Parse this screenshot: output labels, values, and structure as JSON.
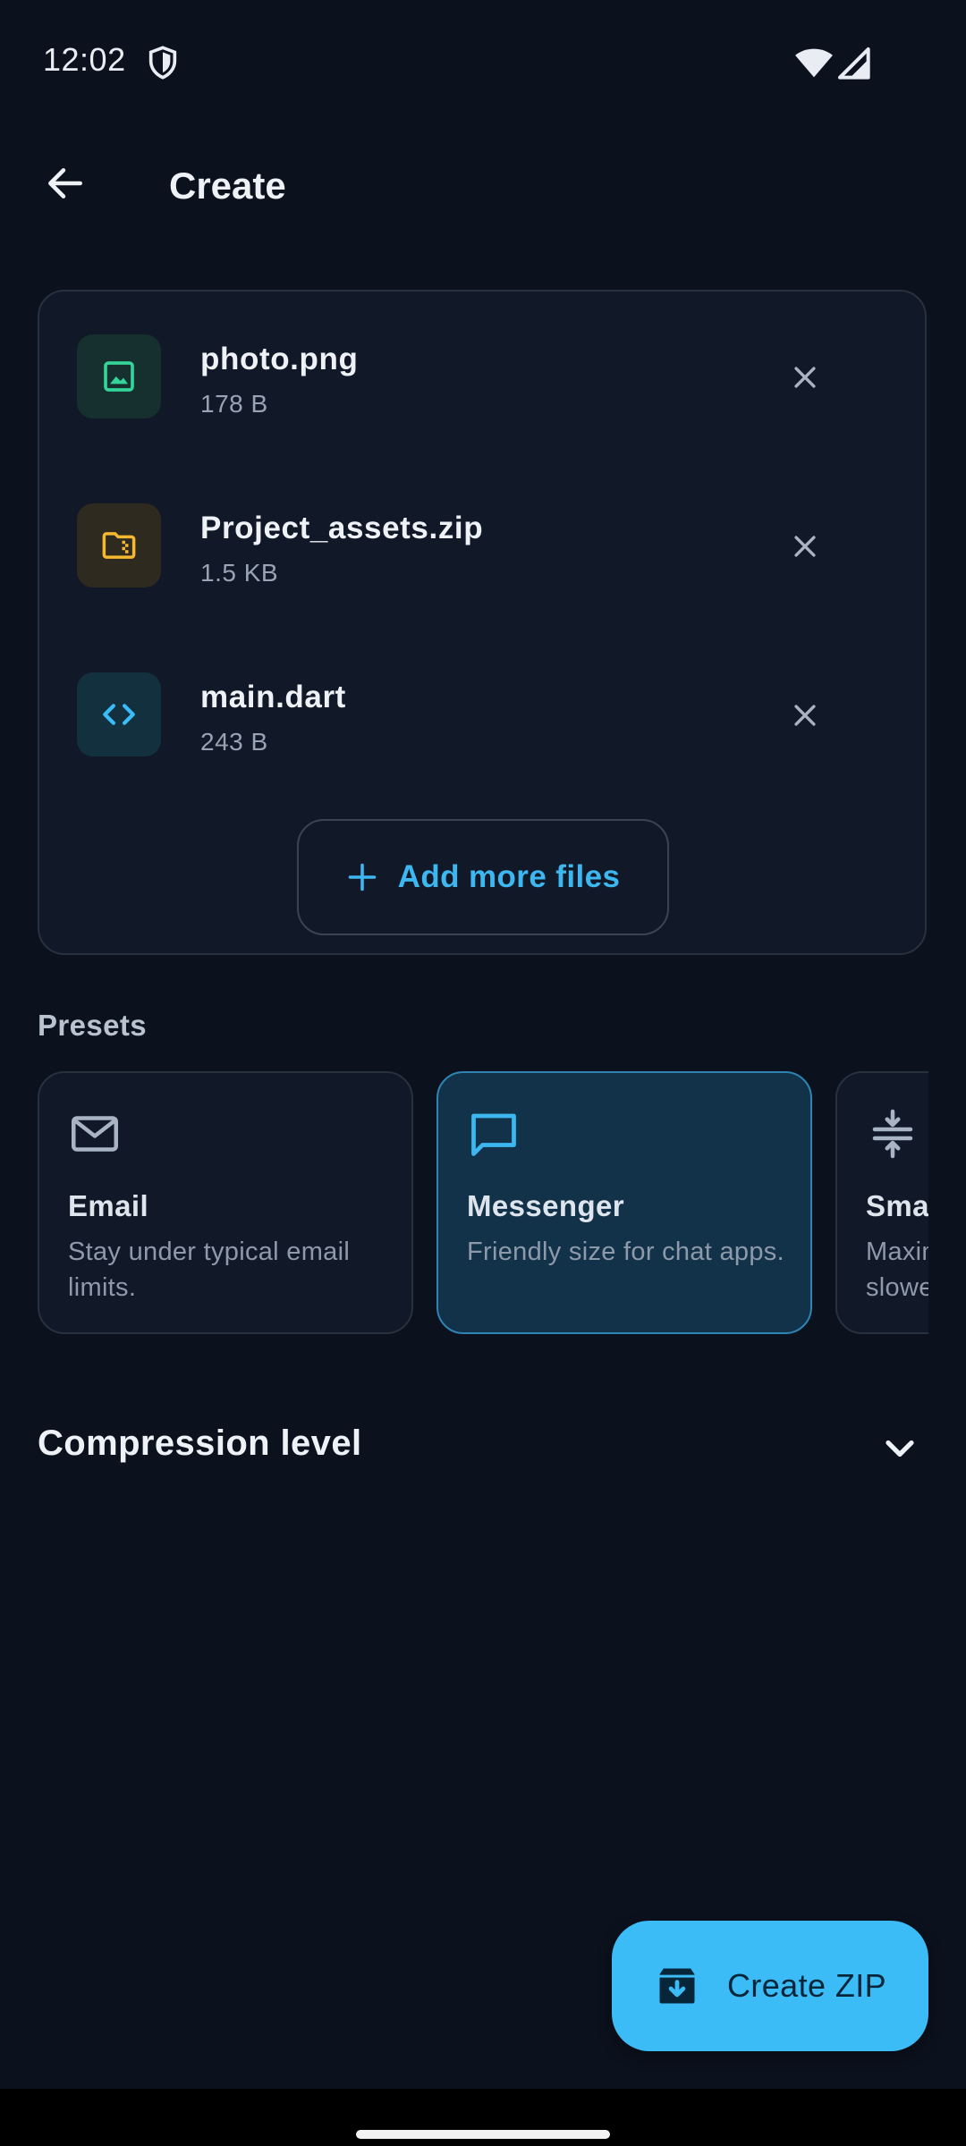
{
  "status_bar": {
    "time": "12:02",
    "icons": [
      "shield-icon",
      "wifi-icon",
      "signal-icon"
    ]
  },
  "app_bar": {
    "title": "Create",
    "back_icon": "arrow-left-icon"
  },
  "files": [
    {
      "name": "photo.png",
      "size": "178 B",
      "icon": "image-icon",
      "icon_color": "#34d399",
      "icon_bg": "#15302e"
    },
    {
      "name": "Project_assets.zip",
      "size": "1.5 KB",
      "icon": "folder-zip-icon",
      "icon_color": "#f5b82e",
      "icon_bg": "#2e2a20"
    },
    {
      "name": "main.dart",
      "size": "243 B",
      "icon": "code-icon",
      "icon_color": "#38bdf8",
      "icon_bg": "#13303f"
    }
  ],
  "add_more": {
    "label": "Add more files"
  },
  "presets": {
    "heading": "Presets",
    "items": [
      {
        "title": "Email",
        "desc": "Stay under typical email limits.",
        "icon": "mail-icon",
        "selected": false
      },
      {
        "title": "Messenger",
        "desc": "Friendly size for chat apps.",
        "icon": "chat-icon",
        "selected": true
      },
      {
        "title": "Smallest",
        "desc": "Maximum compression, slower.",
        "icon": "compress-icon",
        "selected": false
      }
    ]
  },
  "compression": {
    "title": "Compression level"
  },
  "fab": {
    "label": "Create ZIP",
    "icon": "archive-icon"
  },
  "colors": {
    "background": "#0b111d",
    "accent": "#3cbcf7",
    "card": "#111827",
    "selected_card": "#12324a"
  }
}
